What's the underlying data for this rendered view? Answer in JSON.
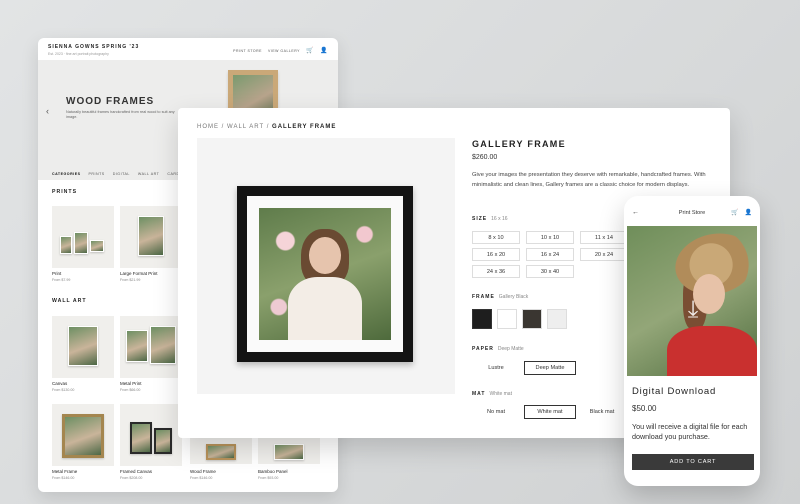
{
  "store": {
    "brand": "SIENNA GOWNS SPRING '23",
    "tagline": "Est. 2023 · fine art portrait photography",
    "nav": [
      "PRINT STORE",
      "VIEW GALLERY"
    ],
    "hero": {
      "title": "WOOD FRAMES",
      "subtitle": "Naturally beautiful frames handcrafted from real wood to suit any image."
    },
    "tabs": [
      "CATEGORIES",
      "PRINTS",
      "DIGITAL",
      "WALL ART",
      "CARDS"
    ],
    "sections": [
      {
        "title": "PRINTS",
        "items": [
          {
            "label": "Print",
            "price": "From $7.99"
          },
          {
            "label": "Large Format Print",
            "price": "From $21.99"
          }
        ]
      },
      {
        "title": "WALL ART",
        "items": [
          {
            "label": "Canvas",
            "price": "From $130.00"
          },
          {
            "label": "Metal Print",
            "price": "From $66.00"
          },
          {
            "label": "Metal Frame",
            "price": "From $146.00"
          },
          {
            "label": "Framed Canvas",
            "price": "From $208.00"
          },
          {
            "label": "Wood Frame",
            "price": "From $146.00"
          },
          {
            "label": "Bamboo Panel",
            "price": "From $93.00"
          }
        ]
      }
    ]
  },
  "product": {
    "breadcrumb": [
      "HOME",
      "WALL ART",
      "GALLERY FRAME"
    ],
    "title": "GALLERY FRAME",
    "price": "$260.00",
    "description": "Give your images the presentation they deserve with remarkable, handcrafted frames. With minimalistic and clean lines, Gallery frames are a classic choice for modern displays.",
    "size": {
      "label": "SIZE",
      "selected": "16 x 16",
      "options": [
        "8 x 10",
        "10 x 10",
        "11 x 14",
        "16 x 20",
        "16 x 24",
        "20 x 24",
        "24 x 36",
        "30 x 40"
      ]
    },
    "frame": {
      "label": "FRAME",
      "selected": "Gallery Black",
      "swatches": [
        "#1e1e1e",
        "#ffffff",
        "#3a3631",
        "#eeeeee"
      ]
    },
    "paper": {
      "label": "PAPER",
      "selected": "Deep Matte",
      "options": [
        "Lustre",
        "Deep Matte"
      ]
    },
    "mat": {
      "label": "MAT",
      "selected": "White mat",
      "options": [
        "No mat",
        "White mat",
        "Black mat"
      ]
    }
  },
  "phone": {
    "title": "Print Store",
    "product_name": "Digital Download",
    "price": "$50.00",
    "description": "You will receive a digital file for each download you purchase.",
    "cart_button": "ADD TO CART"
  }
}
